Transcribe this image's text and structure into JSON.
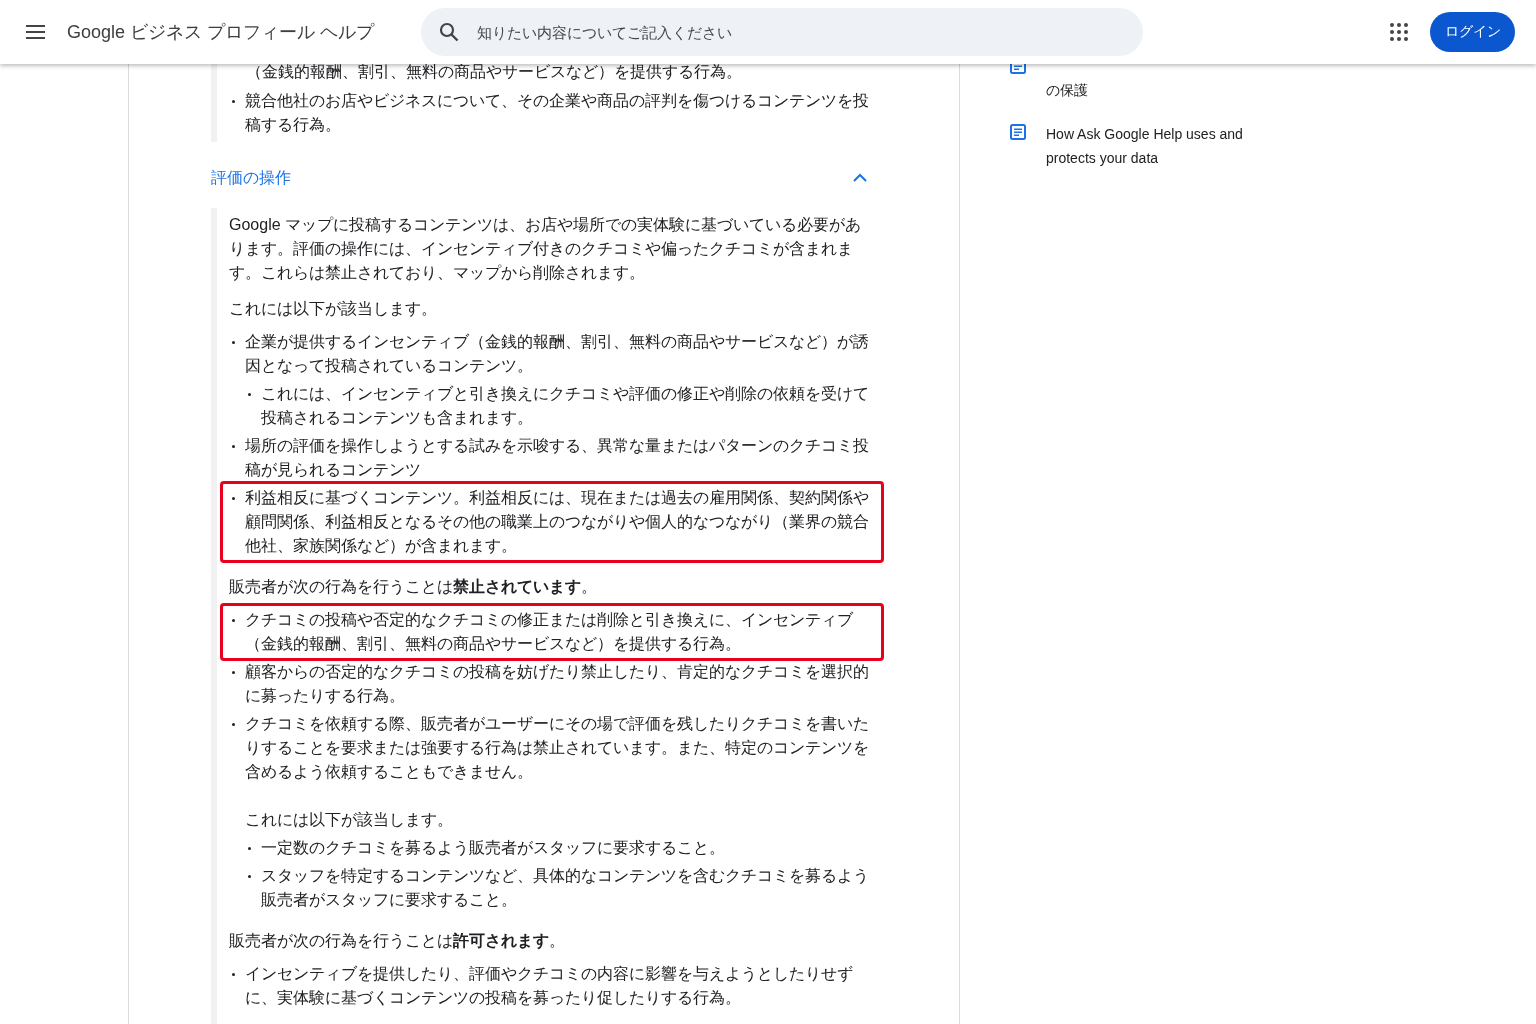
{
  "header": {
    "title": "Google ビジネス プロフィール ヘルプ",
    "search": {
      "placeholder": "知りたい内容についてご記入ください"
    },
    "login_button": "ログイン"
  },
  "top_section": [
    {
      "kind": "continuation",
      "text": "（金銭的報酬、割引、無料の商品やサービスなど）を提供する行為。"
    },
    {
      "kind": "bullet",
      "text": "競合他社のお店やビジネスについて、その企業や商品の評判を傷つけるコンテンツを投稿する行為。"
    }
  ],
  "accordion": {
    "title": "評価の操作",
    "expanded": true,
    "blocks": [
      {
        "kind": "paragraph",
        "text": "Google マップに投稿するコンテンツは、お店や場所での実体験に基づいている必要があります。評価の操作には、インセンティブ付きのクチコミや偏ったクチコミが含まれます。これらは禁止されており、マップから削除されます。"
      },
      {
        "kind": "paragraph",
        "text": "これには以下が該当します。"
      },
      {
        "kind": "list",
        "items": [
          {
            "text": "企業が提供するインセンティブ（金銭的報酬、割引、無料の商品やサービスなど）が誘因となって投稿されているコンテンツ。",
            "highlighted": false,
            "children": [
              {
                "text": "これには、インセンティブと引き換えにクチコミや評価の修正や削除の依頼を受けて投稿されるコンテンツも含まれます。"
              }
            ]
          },
          {
            "text": "場所の評価を操作しようとする試みを示唆する、異常な量またはパターンのクチコミ投稿が見られるコンテンツ",
            "highlighted": false
          },
          {
            "text": "利益相反に基づくコンテンツ。利益相反には、現在または過去の雇用関係、契約関係や顧問関係、利益相反となるその他の職業上のつながりや個人的なつながり（業界の競合他社、家族関係など）が含まれます。",
            "highlighted": true
          }
        ]
      },
      {
        "kind": "paragraph",
        "text": "販売者が次の行為を行うことは**禁止されています**。"
      },
      {
        "kind": "list",
        "items": [
          {
            "text": "クチコミの投稿や否定的なクチコミの修正または削除と引き換えに、インセンティブ（金銭的報酬、割引、無料の商品やサービスなど）を提供する行為。",
            "highlighted": true
          },
          {
            "text": "顧客からの否定的なクチコミの投稿を妨げたり禁止したり、肯定的なクチコミを選択的に募ったりする行為。",
            "highlighted": false
          },
          {
            "text": "クチコミを依頼する際、販売者がユーザーにその場で評価を残したりクチコミを書いたりすることを要求または強要する行為は禁止されています。また、特定のコンテンツを含めるよう依頼することもできません。",
            "highlighted": false,
            "note": "これには以下が該当します。",
            "children": [
              {
                "text": "一定数のクチコミを募るよう販売者がスタッフに要求すること。"
              },
              {
                "text": "スタッフを特定するコンテンツなど、具体的なコンテンツを含むクチコミを募るよう販売者がスタッフに要求すること。"
              }
            ]
          }
        ]
      },
      {
        "kind": "paragraph",
        "text": "販売者が次の行為を行うことは**許可されます**。"
      },
      {
        "kind": "list",
        "items": [
          {
            "text": "インセンティブを提供したり、評価やクチコミの内容に影響を与えようとしたりせずに、実体験に基づくコンテンツの投稿を募ったり促したりする行為。",
            "highlighted": false
          }
        ]
      }
    ]
  },
  "sidebar": {
    "items": [
      {
        "text": "の保護"
      },
      {
        "text": "How Ask Google Help uses and protects your data"
      }
    ]
  }
}
